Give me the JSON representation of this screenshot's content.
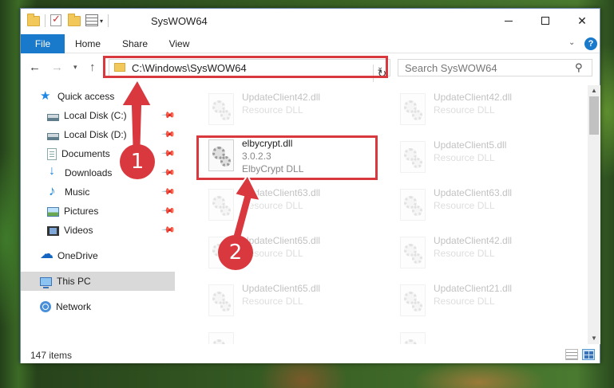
{
  "window": {
    "title": "SysWOW64"
  },
  "ribbon": {
    "tabs": [
      "File",
      "Home",
      "Share",
      "View"
    ],
    "help": "?"
  },
  "nav": {
    "address": "C:\\Windows\\SysWOW64",
    "search_placeholder": "Search SysWOW64"
  },
  "sidebar": {
    "items": [
      {
        "label": "Quick access",
        "icon": "star-icon"
      },
      {
        "label": "Local Disk (C:)",
        "icon": "drive-icon",
        "pinned": true
      },
      {
        "label": "Local Disk (D:)",
        "icon": "drive-icon",
        "pinned": true
      },
      {
        "label": "Documents",
        "icon": "documents-icon",
        "pinned": true
      },
      {
        "label": "Downloads",
        "icon": "downloads-icon",
        "pinned": true
      },
      {
        "label": "Music",
        "icon": "music-icon",
        "pinned": true
      },
      {
        "label": "Pictures",
        "icon": "pictures-icon",
        "pinned": true
      },
      {
        "label": "Videos",
        "icon": "videos-icon",
        "pinned": true
      },
      {
        "label": "OneDrive",
        "icon": "onedrive-icon"
      },
      {
        "label": "This PC",
        "icon": "this-pc-icon",
        "selected": true
      },
      {
        "label": "Network",
        "icon": "network-icon"
      }
    ]
  },
  "files": {
    "highlighted": {
      "name": "elbycrypt.dll",
      "version": "3.0.2.3",
      "description": "ElbyCrypt DLL"
    },
    "background": [
      {
        "name": "UpdateClient42.dll",
        "type": "Resource DLL"
      },
      {
        "name": "UpdateClient42.dll",
        "type": "Resource DLL"
      },
      {
        "name": "UpdateClient5.dll",
        "type": "Resource DLL"
      },
      {
        "name": "UpdateClient63.dll",
        "type": "Resource DLL"
      },
      {
        "name": "UpdateClient63.dll",
        "type": "Resource DLL"
      },
      {
        "name": "UpdateClient65.dll",
        "type": "Resource DLL"
      },
      {
        "name": "UpdateClient42.dll",
        "type": "Resource DLL"
      },
      {
        "name": "UpdateClient65.dll",
        "type": "Resource DLL"
      },
      {
        "name": "UpdateClient21.dll",
        "type": "Resource DLL"
      }
    ]
  },
  "status": {
    "item_count": "147 items"
  },
  "annotations": {
    "step1": "1",
    "step2": "2",
    "color": "#d9383e"
  }
}
